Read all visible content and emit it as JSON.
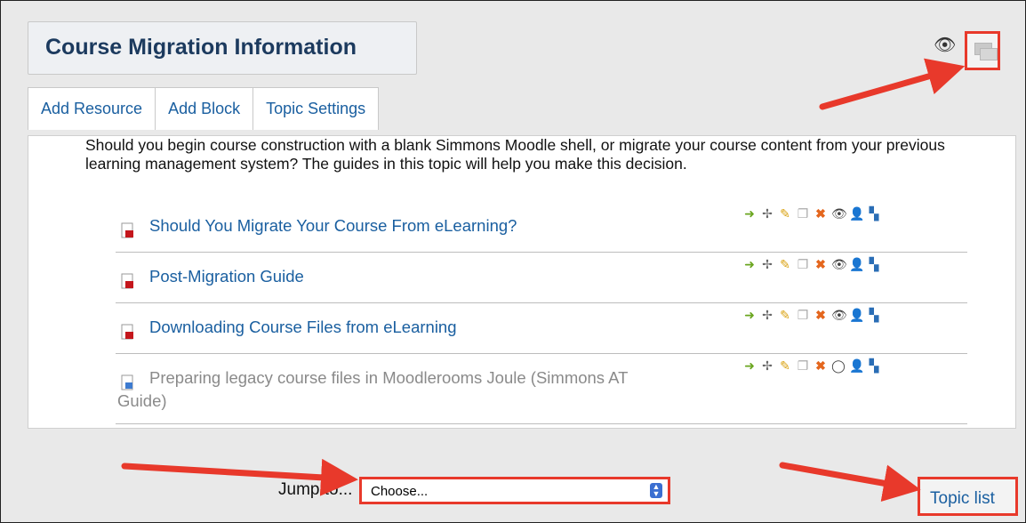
{
  "section": {
    "title": "Course Migration Information",
    "tabs": [
      "Add Resource",
      "Add Block",
      "Topic Settings"
    ],
    "intro": "Should you begin course construction with a blank Simmons Moodle shell, or migrate your course content from your previous learning management system? The guides in this topic will help you make this decision."
  },
  "resources": [
    {
      "label": "Should You Migrate Your Course From eLearning?",
      "type": "pdf",
      "hidden": false
    },
    {
      "label": "Post-Migration Guide",
      "type": "pdf",
      "hidden": false
    },
    {
      "label": "Downloading Course Files from eLearning",
      "type": "pdf",
      "hidden": false
    },
    {
      "label": "Preparing legacy course files in Moodlerooms Joule (Simmons AT",
      "label_line2": "Guide)",
      "type": "word",
      "hidden": true
    }
  ],
  "edit_icons": [
    "indent-right-icon",
    "move-icon",
    "edit-pencil-icon",
    "duplicate-icon",
    "delete-icon",
    "eye-icon",
    "assign-roles-icon",
    "group-mode-icon"
  ],
  "footer": {
    "jump_label": "Jump to...",
    "select_value": "Choose...",
    "topic_list_label": "Topic list"
  },
  "colors": {
    "link": "#1a5fa0",
    "highlight": "#e8392b",
    "title": "#1c3a5e"
  }
}
